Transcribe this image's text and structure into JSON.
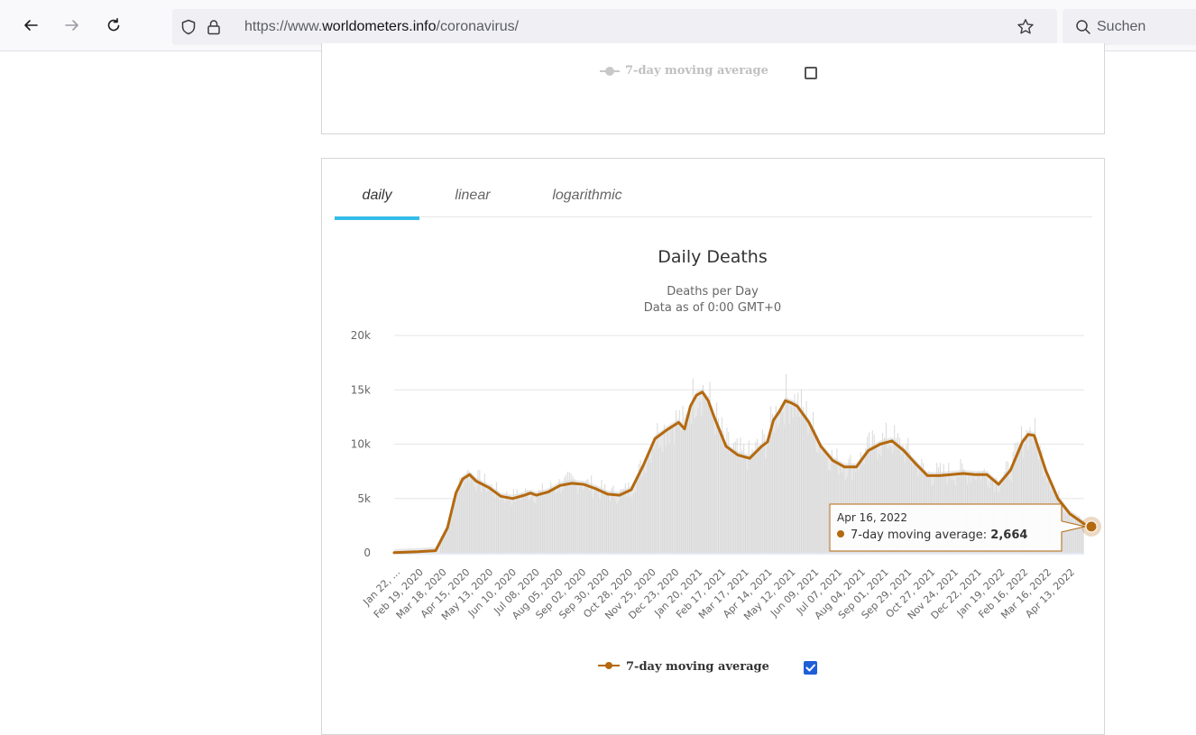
{
  "browser": {
    "url_prefix": "https://www.",
    "url_host": "worldometers.info",
    "url_path": "/coronavirus/",
    "search_placeholder": "Suchen",
    "icons": [
      "back-icon",
      "forward-icon",
      "reload-icon",
      "shield-icon",
      "lock-icon",
      "star-icon",
      "search-icon"
    ]
  },
  "top_panel": {
    "legend_label": "7-day moving average",
    "legend_checked": false,
    "legend_color": "#c8c8c8"
  },
  "tabs": [
    {
      "label": "daily",
      "active": true
    },
    {
      "label": "linear",
      "active": false
    },
    {
      "label": "logarithmic",
      "active": false
    }
  ],
  "colors": {
    "accent_tab": "#34bde9",
    "series_line": "#b4690f",
    "bars": "#d8d8d8",
    "area": "#e8e8e8",
    "checkbox": "#1f5fd6"
  },
  "chart_data": {
    "type": "line",
    "title": "Daily Deaths",
    "subtitle_1": "Deaths per Day",
    "subtitle_2": "Data as of 0:00 GMT+0",
    "ylim": [
      0,
      20000
    ],
    "y_ticks": [
      {
        "value": 0,
        "label": "0"
      },
      {
        "value": 5000,
        "label": "5k"
      },
      {
        "value": 10000,
        "label": "10k"
      },
      {
        "value": 15000,
        "label": "15k"
      },
      {
        "value": 20000,
        "label": "20k"
      }
    ],
    "x_tick_labels": [
      "Jan 22, ...",
      "Feb 19, 2020",
      "Mar 18, 2020",
      "Apr 15, 2020",
      "May 13, 2020",
      "Jun 10, 2020",
      "Jul 08, 2020",
      "Aug 05, 2020",
      "Sep 02, 2020",
      "Sep 30, 2020",
      "Oct 28, 2020",
      "Nov 25, 2020",
      "Dec 23, 2020",
      "Jan 20, 2021",
      "Feb 17, 2021",
      "Mar 17, 2021",
      "Apr 14, 2021",
      "May 12, 2021",
      "Jun 09, 2021",
      "Jul 07, 2021",
      "Aug 04, 2021",
      "Sep 01, 2021",
      "Sep 29, 2021",
      "Oct 27, 2021",
      "Nov 24, 2021",
      "Dec 22, 2021",
      "Jan 19, 2022",
      "Feb 16, 2022",
      "Mar 16, 2022",
      "Apr 13, 2022"
    ],
    "series": [
      {
        "name": "7-day moving average",
        "points": [
          {
            "x": "Jan 22, 2020",
            "y": 20
          },
          {
            "x": "Feb 19, 2020",
            "y": 100
          },
          {
            "x": "Mar 11, 2020",
            "y": 200
          },
          {
            "x": "Mar 25, 2020",
            "y": 2300
          },
          {
            "x": "Apr 04, 2020",
            "y": 5500
          },
          {
            "x": "Apr 12, 2020",
            "y": 6800
          },
          {
            "x": "Apr 20, 2020",
            "y": 7200
          },
          {
            "x": "Apr 28, 2020",
            "y": 6600
          },
          {
            "x": "May 13, 2020",
            "y": 6000
          },
          {
            "x": "May 27, 2020",
            "y": 5200
          },
          {
            "x": "Jun 10, 2020",
            "y": 5000
          },
          {
            "x": "Jun 24, 2020",
            "y": 5300
          },
          {
            "x": "Jul 01, 2020",
            "y": 5500
          },
          {
            "x": "Jul 08, 2020",
            "y": 5300
          },
          {
            "x": "Jul 22, 2020",
            "y": 5600
          },
          {
            "x": "Aug 05, 2020",
            "y": 6200
          },
          {
            "x": "Aug 19, 2020",
            "y": 6400
          },
          {
            "x": "Sep 02, 2020",
            "y": 6300
          },
          {
            "x": "Sep 16, 2020",
            "y": 5900
          },
          {
            "x": "Sep 30, 2020",
            "y": 5400
          },
          {
            "x": "Oct 14, 2020",
            "y": 5300
          },
          {
            "x": "Oct 28, 2020",
            "y": 5800
          },
          {
            "x": "Nov 11, 2020",
            "y": 8000
          },
          {
            "x": "Nov 25, 2020",
            "y": 10500
          },
          {
            "x": "Dec 09, 2020",
            "y": 11300
          },
          {
            "x": "Dec 23, 2020",
            "y": 12000
          },
          {
            "x": "Dec 30, 2020",
            "y": 11400
          },
          {
            "x": "Jan 06, 2021",
            "y": 13500
          },
          {
            "x": "Jan 13, 2021",
            "y": 14500
          },
          {
            "x": "Jan 20, 2021",
            "y": 14800
          },
          {
            "x": "Jan 27, 2021",
            "y": 14000
          },
          {
            "x": "Feb 03, 2021",
            "y": 12500
          },
          {
            "x": "Feb 17, 2021",
            "y": 9800
          },
          {
            "x": "Mar 03, 2021",
            "y": 9000
          },
          {
            "x": "Mar 17, 2021",
            "y": 8700
          },
          {
            "x": "Mar 31, 2021",
            "y": 9800
          },
          {
            "x": "Apr 07, 2021",
            "y": 10200
          },
          {
            "x": "Apr 14, 2021",
            "y": 12200
          },
          {
            "x": "Apr 21, 2021",
            "y": 13000
          },
          {
            "x": "Apr 28, 2021",
            "y": 14000
          },
          {
            "x": "May 05, 2021",
            "y": 13800
          },
          {
            "x": "May 12, 2021",
            "y": 13500
          },
          {
            "x": "May 26, 2021",
            "y": 12000
          },
          {
            "x": "Jun 09, 2021",
            "y": 9800
          },
          {
            "x": "Jun 23, 2021",
            "y": 8500
          },
          {
            "x": "Jul 07, 2021",
            "y": 7900
          },
          {
            "x": "Jul 21, 2021",
            "y": 7900
          },
          {
            "x": "Aug 04, 2021",
            "y": 9400
          },
          {
            "x": "Aug 18, 2021",
            "y": 10000
          },
          {
            "x": "Sep 01, 2021",
            "y": 10300
          },
          {
            "x": "Sep 15, 2021",
            "y": 9400
          },
          {
            "x": "Sep 29, 2021",
            "y": 8200
          },
          {
            "x": "Oct 13, 2021",
            "y": 7100
          },
          {
            "x": "Oct 27, 2021",
            "y": 7100
          },
          {
            "x": "Nov 10, 2021",
            "y": 7200
          },
          {
            "x": "Nov 24, 2021",
            "y": 7300
          },
          {
            "x": "Dec 08, 2021",
            "y": 7200
          },
          {
            "x": "Dec 22, 2021",
            "y": 7200
          },
          {
            "x": "Jan 05, 2022",
            "y": 6300
          },
          {
            "x": "Jan 19, 2022",
            "y": 7600
          },
          {
            "x": "Feb 02, 2022",
            "y": 10200
          },
          {
            "x": "Feb 09, 2022",
            "y": 10900
          },
          {
            "x": "Feb 16, 2022",
            "y": 10800
          },
          {
            "x": "Mar 02, 2022",
            "y": 7500
          },
          {
            "x": "Mar 16, 2022",
            "y": 5000
          },
          {
            "x": "Mar 30, 2022",
            "y": 3600
          },
          {
            "x": "Apr 16, 2022",
            "y": 2664
          }
        ]
      }
    ],
    "legend_label": "7-day moving average",
    "legend_checked": true,
    "tooltip": {
      "date": "Apr 16, 2022",
      "series_label": "7-day moving average:",
      "value_text": "2,664",
      "value": 2664
    },
    "grid": true
  }
}
